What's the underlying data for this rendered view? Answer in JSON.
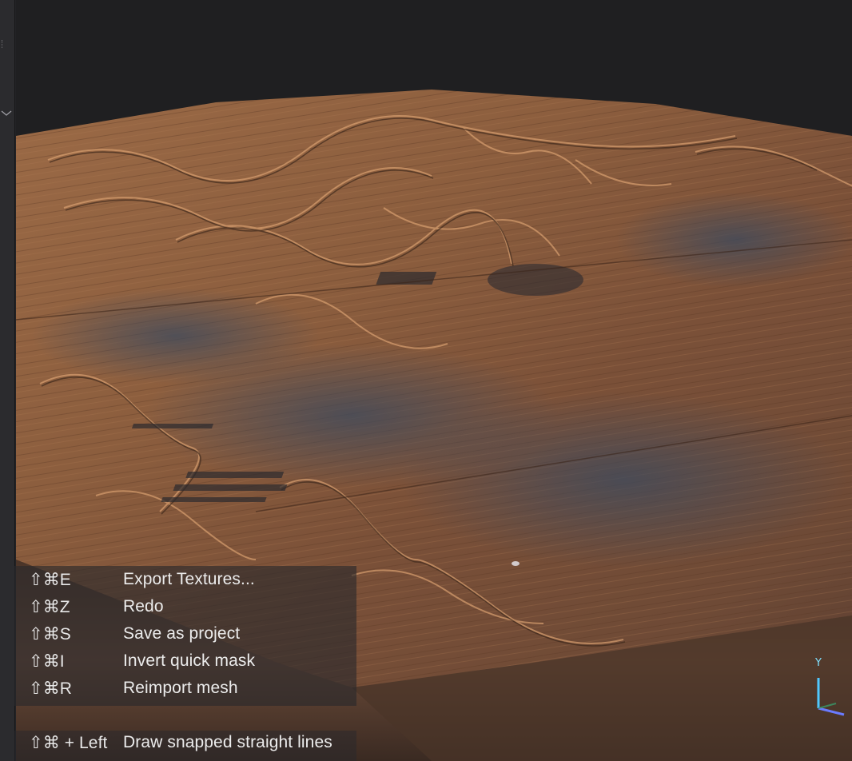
{
  "viewport": {
    "axis_label_y": "Y"
  },
  "shortcuts": [
    {
      "keys": "⇧⌘E",
      "label": "Export Textures..."
    },
    {
      "keys": "⇧⌘Z",
      "label": "Redo"
    },
    {
      "keys": "⇧⌘S",
      "label": "Save as project"
    },
    {
      "keys": "⇧⌘I",
      "label": "Invert quick mask"
    },
    {
      "keys": "⇧⌘R",
      "label": "Reimport mesh"
    }
  ],
  "shortcut_extra": {
    "keys": "⇧⌘ + Left",
    "label": "Draw snapped straight lines"
  },
  "icons": {
    "collapse": "chevron-down-icon",
    "axis": "axis-gizmo-icon"
  },
  "colors": {
    "background": "#232326",
    "wood_base": "#8a5a3a",
    "wood_dark": "#3a2a22",
    "wood_highlight": "#c48a5c",
    "overlay_bg": "rgba(40,40,44,0.62)",
    "axis_y": "#4fc8ff",
    "axis_x": "#6a7bff"
  }
}
